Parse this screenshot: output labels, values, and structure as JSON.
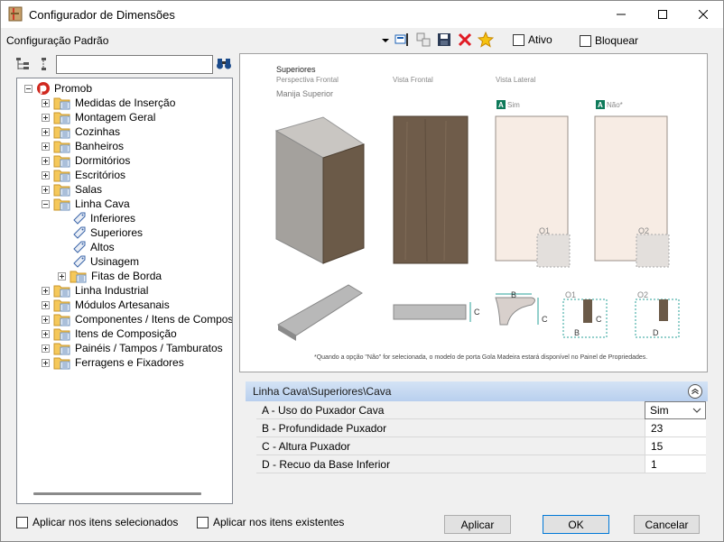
{
  "window": {
    "title": "Configurador de Dimensões"
  },
  "toolbar": {
    "config_label": "Configuração Padrão",
    "ativo_label": "Ativo",
    "bloquear_label": "Bloquear"
  },
  "tree": {
    "root": "Promob",
    "items": [
      "Medidas de Inserção",
      "Montagem Geral",
      "Cozinhas",
      "Banheiros",
      "Dormitórios",
      "Escritórios",
      "Salas",
      "Linha Cava",
      "Inferiores",
      "Superiores",
      "Altos",
      "Usinagem",
      "Fitas de Borda",
      "Linha Industrial",
      "Módulos Artesanais",
      "Componentes / Itens de Composição",
      "Itens de Composição",
      "Painéis / Tampos / Tamburatos",
      "Ferragens e Fixadores"
    ]
  },
  "preview": {
    "title": "Superiores",
    "sub_perspectiva": "Perspectiva Frontal",
    "sub_frontal": "Vista Frontal",
    "sub_lateral": "Vista Lateral",
    "manija": "Manija Superior",
    "tag_a": "A",
    "sim": "Sim",
    "nao": "Não*",
    "o1": "O1",
    "o2": "O2",
    "lbl_b": "B",
    "lbl_c": "C",
    "lbl_d": "D",
    "note": "*Quando a opção \"Não\" for selecionada, o modelo de porta Gola Madeira estará disponível no Painel de Propriedades."
  },
  "properties": {
    "header": "Linha Cava\\Superiores\\Cava",
    "rows": [
      {
        "name": "A - Uso do Puxador Cava",
        "value": "Sim"
      },
      {
        "name": "B - Profundidade Puxador",
        "value": "23"
      },
      {
        "name": "C - Altura Puxador",
        "value": "15"
      },
      {
        "name": "D - Recuo da Base Inferior",
        "value": "1"
      }
    ]
  },
  "footer": {
    "apply_selected": "Aplicar nos itens selecionados",
    "apply_existing": "Aplicar nos itens existentes",
    "apply_button": "Aplicar",
    "ok_button": "OK",
    "cancel_button": "Cancelar"
  },
  "colors": {
    "accent": "#0078d7",
    "header_bg": "#c6d9f1",
    "wood": "#6b5a48"
  }
}
